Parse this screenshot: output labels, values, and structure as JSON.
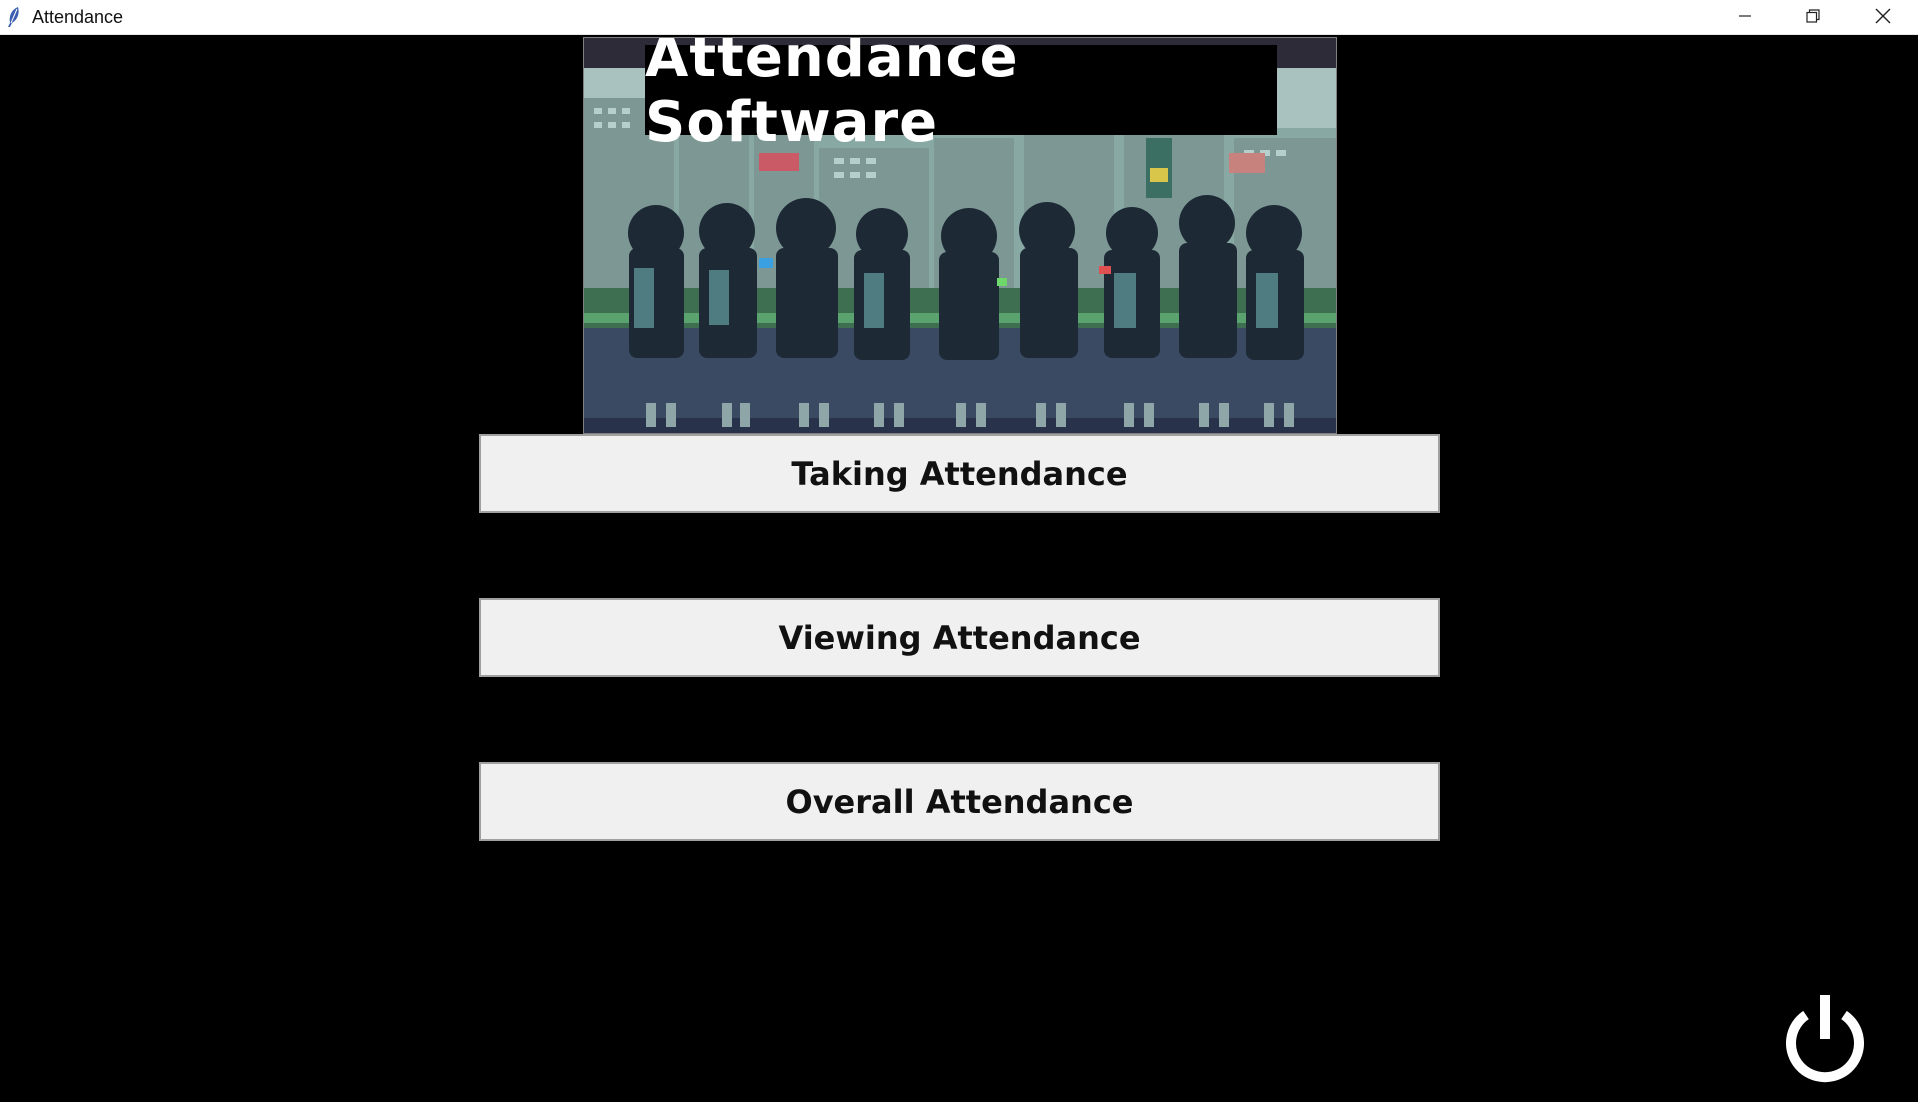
{
  "window": {
    "title": "Attendance",
    "icon": "feather-icon",
    "controls": [
      "minimize-icon",
      "restore-icon",
      "close-icon"
    ]
  },
  "banner": {
    "title": "Attendance Software",
    "image": "pixel-art-students-city-scene"
  },
  "menu": {
    "taking": "Taking Attendance",
    "viewing": "Viewing Attendance",
    "overall": "Overall Attendance"
  },
  "power": {
    "icon": "power-icon"
  },
  "colors": {
    "background": "#000000",
    "button_bg": "#f0f0f0",
    "button_border": "#a0a0a0",
    "button_text": "#111111",
    "banner_title_bg": "#000000",
    "banner_title_text": "#ffffff"
  }
}
